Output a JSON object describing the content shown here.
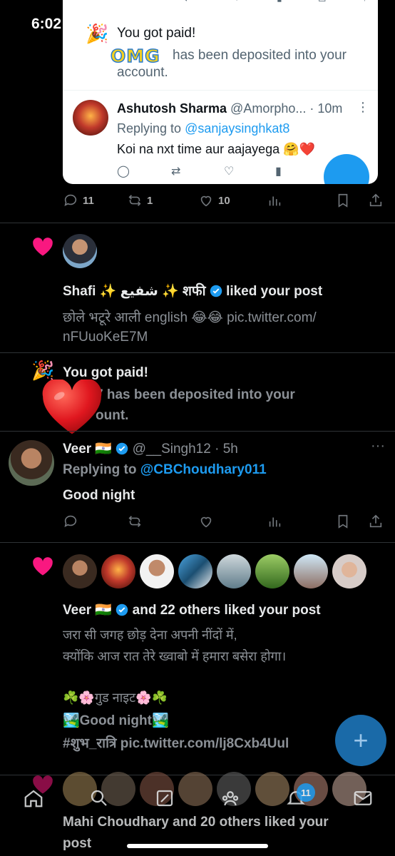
{
  "status_bar": {
    "time": "6:02"
  },
  "embed": {
    "paid_title": "You got paid!",
    "paid_body": "has been deposited into your account.",
    "omg_text": "OMG",
    "reply_name": "Ashutosh Sharma",
    "reply_handle_time": "@Amorpho... · 10m",
    "replying_to_prefix": "Replying to",
    "replying_to_handle": "@sanjaysinghkat8",
    "reply_text": "Koi na nxt time aur aajayega 🤗❤️"
  },
  "top_actions": {
    "replies": "11",
    "reposts": "1",
    "likes": "10"
  },
  "notif_shafi": {
    "name": "Shafi ✨ شفیع ✨ शफी",
    "action": "liked your post",
    "text_line1_a": "छोले भटूरे आली english 😂😂",
    "text_line1_link": "pic.twitter.com/",
    "text_line2_link": "nFUuoKeE7M"
  },
  "notif_paid": {
    "title": "You got paid!",
    "body_line1": "7 has been deposited into your",
    "body_line2": "ount."
  },
  "tweet_veer": {
    "name": "Veer 🇮🇳",
    "handle_time": "@__Singh12 · 5h",
    "replying_prefix": "Replying to",
    "replying_handle": "@CBChoudhary011",
    "text": "Good night"
  },
  "notif_veer_likes": {
    "name": "Veer 🇮🇳",
    "action": "and 22 others liked your post",
    "line1": "जरा सी जगह छोड़ देना अपनी नींदों में,",
    "line2": "क्योंकि आज रात तेरे ख्वाबो में हमारा बसेरा होगा।",
    "line3": "☘️🌸गुड नाइट🌸☘️",
    "line4": "🏞️Good night🏞️",
    "line5_tag": "#शुभ_रात्रि",
    "line5_link": "pic.twitter.com/lj8Cxb4Uul"
  },
  "notif_mahi": {
    "line1": "Mahi Choudhary and 20 others liked your",
    "line2": "post"
  },
  "nav": {
    "badge": "11"
  },
  "colors": {
    "accent": "#1d9bf0",
    "like": "#f91880",
    "bg": "#000000"
  }
}
